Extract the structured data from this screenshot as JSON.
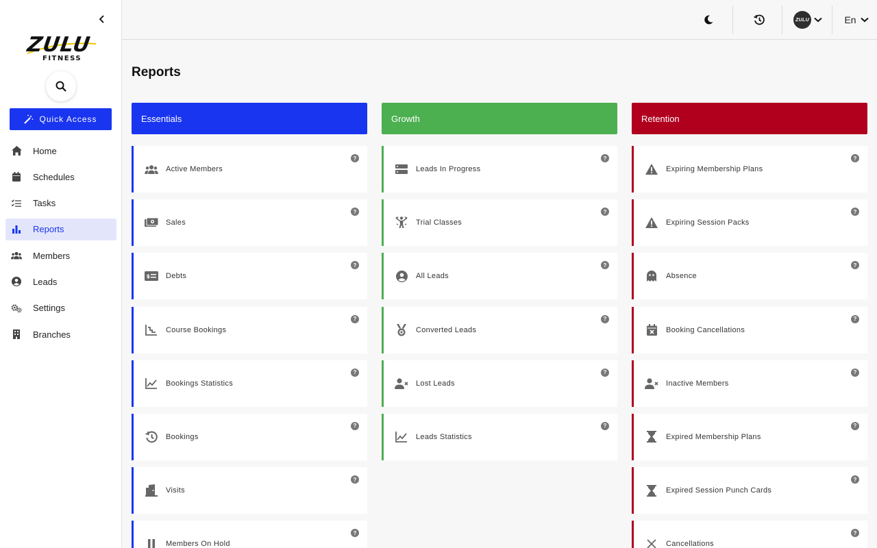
{
  "brand": {
    "name": "ZULU",
    "subtitle": "FITNESS"
  },
  "sidebar": {
    "quick_access_label": "Quick Access",
    "items": [
      {
        "label": "Home",
        "icon": "home-icon"
      },
      {
        "label": "Schedules",
        "icon": "calendar-icon"
      },
      {
        "label": "Tasks",
        "icon": "checklist-icon"
      },
      {
        "label": "Reports",
        "icon": "bar-chart-icon",
        "active": true
      },
      {
        "label": "Members",
        "icon": "people-icon"
      },
      {
        "label": "Leads",
        "icon": "user-circle-icon"
      },
      {
        "label": "Settings",
        "icon": "gears-icon"
      },
      {
        "label": "Branches",
        "icon": "building-icon"
      }
    ]
  },
  "header": {
    "language": "En",
    "avatar_text": "ZULU"
  },
  "page": {
    "title": "Reports"
  },
  "colors": {
    "accent": "#1a35f0",
    "essentials": "#1a35f0",
    "growth": "#4caf50",
    "retention": "#b0001e"
  },
  "columns": [
    {
      "title": "Essentials",
      "cards": [
        {
          "label": "Active Members",
          "icon": "people-icon"
        },
        {
          "label": "Sales",
          "icon": "cash-icon"
        },
        {
          "label": "Debts",
          "icon": "money-card-icon"
        },
        {
          "label": "Course Bookings",
          "icon": "stairs-chart-icon"
        },
        {
          "label": "Bookings Statistics",
          "icon": "line-chart-icon"
        },
        {
          "label": "Bookings",
          "icon": "history-icon"
        },
        {
          "label": "Visits",
          "icon": "door-icon"
        },
        {
          "label": "Members On Hold",
          "icon": "pause-icon"
        }
      ]
    },
    {
      "title": "Growth",
      "cards": [
        {
          "label": "Leads In Progress",
          "icon": "storage-icon"
        },
        {
          "label": "Trial Classes",
          "icon": "sports-icon"
        },
        {
          "label": "All Leads",
          "icon": "user-circle-icon"
        },
        {
          "label": "Converted Leads",
          "icon": "medal-icon"
        },
        {
          "label": "Lost Leads",
          "icon": "person-remove-icon"
        },
        {
          "label": "Leads Statistics",
          "icon": "line-chart-icon"
        }
      ]
    },
    {
      "title": "Retention",
      "cards": [
        {
          "label": "Expiring Membership Plans",
          "icon": "warning-icon"
        },
        {
          "label": "Expiring Session Packs",
          "icon": "warning-icon"
        },
        {
          "label": "Absence",
          "icon": "ghost-icon"
        },
        {
          "label": "Booking Cancellations",
          "icon": "calendar-x-icon"
        },
        {
          "label": "Inactive Members",
          "icon": "person-remove-icon"
        },
        {
          "label": "Expired Membership Plans",
          "icon": "hourglass-icon"
        },
        {
          "label": "Expired Session Punch Cards",
          "icon": "hourglass-icon"
        },
        {
          "label": "Cancellations",
          "icon": "close-icon"
        }
      ]
    }
  ]
}
